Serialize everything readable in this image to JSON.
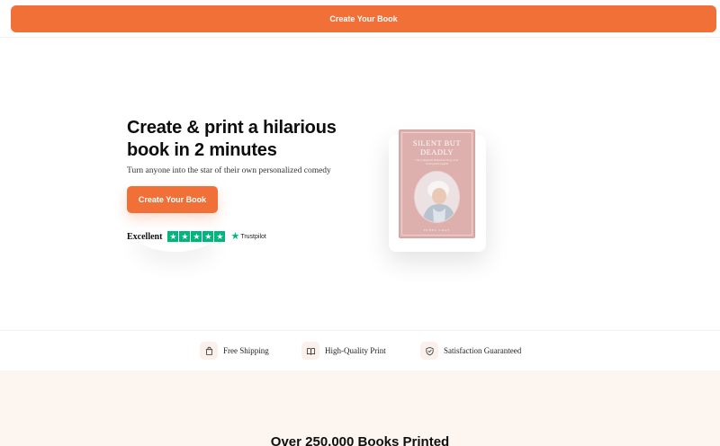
{
  "top_bar": {
    "cta_label": "Create Your Book"
  },
  "hero": {
    "title": "Create & print a hilarious book in 2 minutes",
    "subtitle": "Turn anyone into the star of their own personalized comedy",
    "cta_label": "Create Your Book",
    "rating": {
      "label": "Excellent",
      "stars": 5,
      "provider": "Trustpilot",
      "star_color": "#00b67a"
    }
  },
  "book": {
    "title": "Silent But Deadly",
    "tagline": "The Completely Ridiculous Story of an Unstoppable Legend",
    "author": "Ethel Gray",
    "cover_color": "#ddb0ae"
  },
  "features": [
    {
      "label": "Free Shipping",
      "icon": "shopping-bag-icon"
    },
    {
      "label": "High-Quality Print",
      "icon": "open-book-icon"
    },
    {
      "label": "Satisfaction Guaranteed",
      "icon": "shield-check-icon"
    }
  ],
  "stats": {
    "title": "Over 250,000 Books Printed"
  },
  "colors": {
    "accent": "#f07038",
    "stats_background": "#fcf5f0"
  }
}
